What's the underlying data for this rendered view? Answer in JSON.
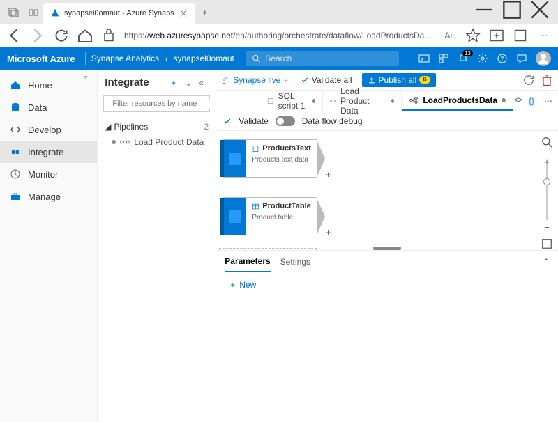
{
  "browser": {
    "tab_title": "synapsel0omaut - Azure Synaps",
    "url_prefix": "https://",
    "url_host": "web.azuresynapse.net",
    "url_path": "/en/authoring/orchestrate/dataflow/LoadProductsData?workspace=%2Fsubscriptions%2Ffd..."
  },
  "azure": {
    "brand": "Microsoft Azure",
    "service": "Synapse Analytics",
    "workspace": "synapsel0omaut",
    "search_placeholder": "Search",
    "notif_count": "13"
  },
  "leftnav": {
    "items": [
      "Home",
      "Data",
      "Develop",
      "Integrate",
      "Monitor",
      "Manage"
    ],
    "active": "Integrate"
  },
  "toolbar": {
    "mode": "Synapse live",
    "validate_all": "Validate all",
    "publish": "Publish all",
    "publish_count": "6"
  },
  "explorer": {
    "title": "Integrate",
    "filter_placeholder": "Filter resources by name",
    "group": "Pipelines",
    "group_count": "2",
    "item": "Load Product Data"
  },
  "editor_tabs": [
    {
      "label": "SQL script 1",
      "icon": "sql",
      "dirty": true
    },
    {
      "label": "Load Product Data",
      "icon": "pipeline",
      "dirty": true
    },
    {
      "label": "LoadProductsData",
      "icon": "dataflow",
      "dirty": true,
      "active": true
    }
  ],
  "subbar": {
    "validate": "Validate",
    "debug": "Data flow debug"
  },
  "flow": {
    "card1": {
      "name": "ProductsText",
      "desc": "Products text data"
    },
    "card2": {
      "name": "ProductTable",
      "desc": "Product table"
    }
  },
  "props": {
    "tabs": [
      "Parameters",
      "Settings"
    ],
    "active": "Parameters",
    "new": "New"
  }
}
